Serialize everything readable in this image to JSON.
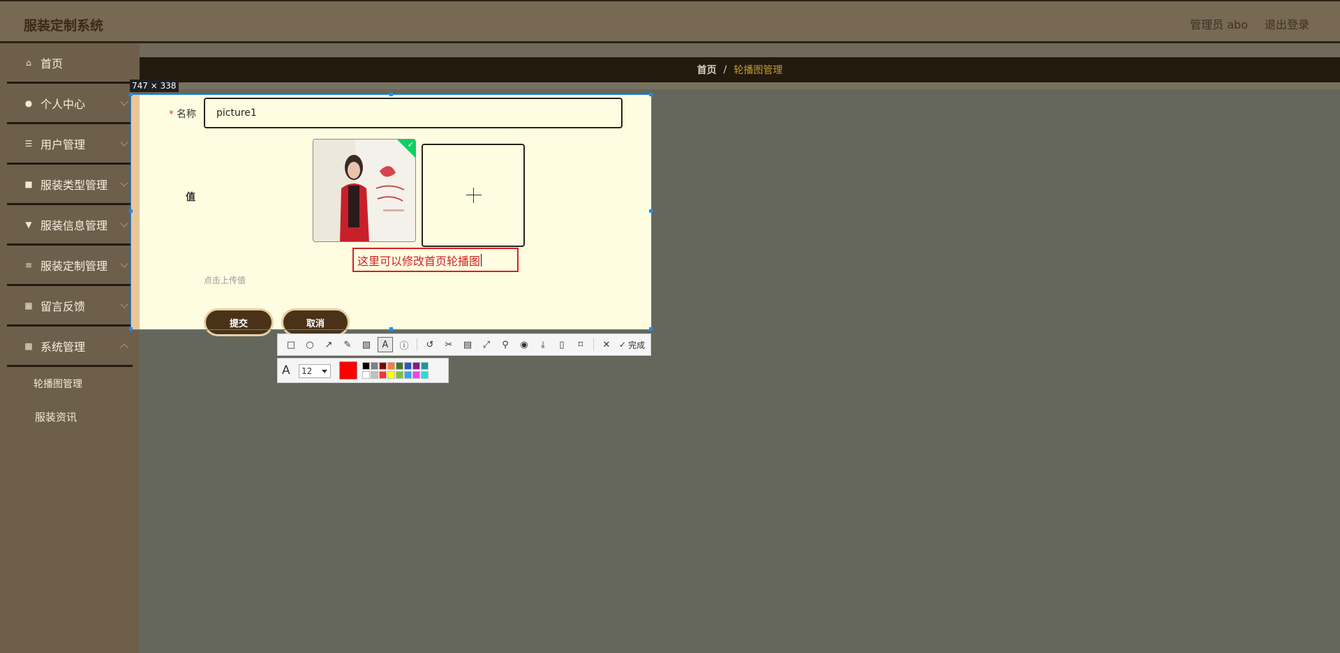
{
  "header": {
    "title": "服装定制系统",
    "admin_label": "管理员 abo",
    "logout": "退出登录"
  },
  "sidebar": {
    "items": [
      {
        "label": "首页",
        "icon": "home-icon",
        "glyph": "⌂"
      },
      {
        "label": "个人中心",
        "icon": "user-icon",
        "glyph": "●"
      },
      {
        "label": "用户管理",
        "icon": "sliders-icon",
        "glyph": "☰"
      },
      {
        "label": "服装类型管理",
        "icon": "briefcase-icon",
        "glyph": "■"
      },
      {
        "label": "服装信息管理",
        "icon": "pin-icon",
        "glyph": "▼"
      },
      {
        "label": "服装定制管理",
        "icon": "list-icon",
        "glyph": "≡"
      },
      {
        "label": "留言反馈",
        "icon": "grid-icon",
        "glyph": "▦"
      },
      {
        "label": "系统管理",
        "icon": "apps-icon",
        "glyph": "▩"
      }
    ],
    "sub_items": [
      "轮播图管理",
      "服装资讯"
    ]
  },
  "breadcrumb": {
    "home": "首页",
    "separator": "/",
    "current": "轮播图管理"
  },
  "capture": {
    "size_label": "747 × 338"
  },
  "form": {
    "name_label": "名称",
    "required_mark": "*",
    "name_value": "picture1",
    "value_label": "值",
    "upload_hint": "点击上传值",
    "submit": "提交",
    "cancel": "取消",
    "annotation_text": "这里可以修改首页轮播图"
  },
  "toolbar": {
    "icons": [
      "rectangle-icon",
      "ellipse-icon",
      "arrow-icon",
      "pen-icon",
      "mosaic-icon",
      "text-icon",
      "number-icon",
      "undo-icon",
      "scissors-icon",
      "ocr-icon",
      "fullscreen-icon",
      "pin-icon",
      "record-icon",
      "download-icon",
      "save-icon",
      "bookmark-icon",
      "close-icon",
      "check-icon"
    ],
    "done_label": "完成"
  },
  "text_tool": {
    "font_size": "12",
    "current_color": "#ff0000",
    "palette": [
      "#000000",
      "#808080",
      "#800000",
      "#f57f3d",
      "#3a7a2a",
      "#3055c8",
      "#7b1f8c",
      "#159a9a",
      "#ffffff",
      "#c0c0c0",
      "#ff3030",
      "#ffff00",
      "#7ec234",
      "#3aa0ff",
      "#ee44ee",
      "#22dddd"
    ]
  },
  "colors": {
    "header_bg": "#786955",
    "sidebar_bg": "#6e5f4b",
    "breadcrumb_bg": "#231a0e",
    "accent": "#c79a2a",
    "button_bg": "#4a3218"
  }
}
